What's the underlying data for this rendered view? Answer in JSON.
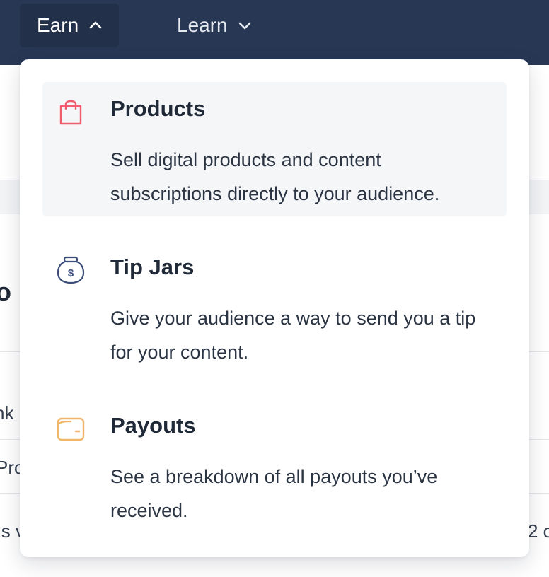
{
  "nav": {
    "items": [
      {
        "label": "Earn",
        "expanded": true
      },
      {
        "label": "Learn",
        "expanded": false
      }
    ]
  },
  "background": {
    "fragments": [
      "o",
      "nk",
      "Pro",
      "is v",
      "2 c"
    ]
  },
  "dropdown": {
    "items": [
      {
        "title": "Products",
        "description": "Sell digital products and content subscriptions directly to your audience.",
        "icon": "shopping-bag-icon",
        "icon_color": "#f05d6c"
      },
      {
        "title": "Tip Jars",
        "description": "Give your audience a way to send you a tip for your content.",
        "icon": "tip-jar-icon",
        "icon_color": "#3c4d7a"
      },
      {
        "title": "Payouts",
        "description": "See a breakdown of all payouts you’ve received.",
        "icon": "wallet-icon",
        "icon_color": "#f1b56e"
      }
    ]
  },
  "colors": {
    "nav_background": "#283754",
    "nav_active": "#223049",
    "highlight": "#f5f6f8"
  }
}
